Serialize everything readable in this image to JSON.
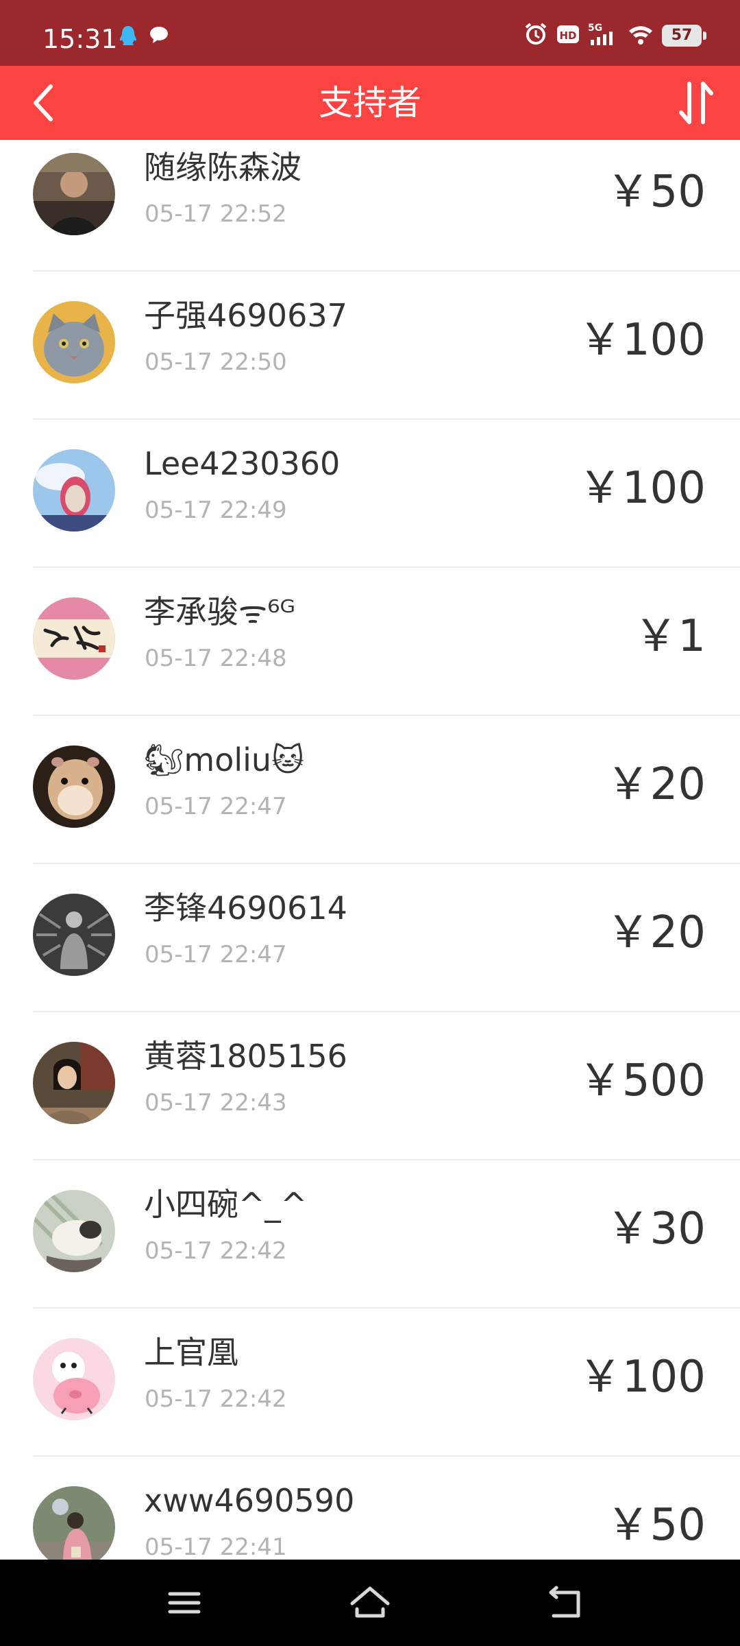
{
  "status_bar": {
    "time": "15:31",
    "battery": "57",
    "left_icons": [
      "qq-icon",
      "chat-bubble-icon"
    ],
    "right_icons": [
      "alarm-icon",
      "hd-icon",
      "5g-signal-icon",
      "wifi-icon",
      "battery-icon"
    ]
  },
  "header": {
    "title": "支持者",
    "background": "#fb4342",
    "back_icon": "back-chevron-icon",
    "sort_icon": "sort-icon"
  },
  "supporters": [
    {
      "name": "随缘陈森波",
      "time": "05-17 22:52",
      "amount": "￥50"
    },
    {
      "name": "子强4690637",
      "time": "05-17 22:50",
      "amount": "￥100"
    },
    {
      "name": "Lee4230360",
      "time": "05-17 22:49",
      "amount": "￥100"
    },
    {
      "name": "李承骏ᯤ⁶ᴳ",
      "time": "05-17 22:48",
      "amount": "￥1"
    },
    {
      "name": "🐿moliu🐱",
      "time": "05-17 22:47",
      "amount": "￥20"
    },
    {
      "name": "李锋4690614",
      "time": "05-17 22:47",
      "amount": "￥20"
    },
    {
      "name": "黄蓉1805156",
      "time": "05-17 22:43",
      "amount": "￥500"
    },
    {
      "name": "小四碗^_^",
      "time": "05-17 22:42",
      "amount": "￥30"
    },
    {
      "name": "上官凰",
      "time": "05-17 22:42",
      "amount": "￥100"
    },
    {
      "name": "xww4690590",
      "time": "05-17 22:41",
      "amount": "￥50"
    }
  ],
  "nav_bar": {
    "icons": [
      "menu-icon",
      "home-icon",
      "back-icon"
    ]
  }
}
